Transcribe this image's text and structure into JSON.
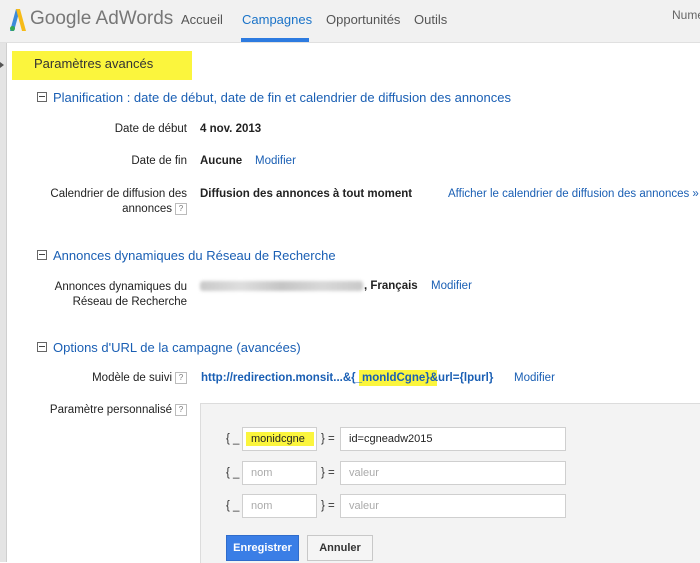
{
  "brand": {
    "google": "Google",
    "product": "AdWords",
    "logo_colors": [
      "#3c8bd9",
      "#f6bb18",
      "#34a853"
    ]
  },
  "nav": {
    "tabs": [
      {
        "label": "Accueil"
      },
      {
        "label": "Campagnes",
        "active": true
      },
      {
        "label": "Opportunités"
      },
      {
        "label": "Outils"
      }
    ],
    "account_label": "Numé"
  },
  "advanced": {
    "title": "Paramètres avancés"
  },
  "scheduling": {
    "header": "Planification : date de début, date de fin et calendrier de diffusion des annonces",
    "start_label": "Date de début",
    "start_value": "4 nov. 2013",
    "end_label": "Date de fin",
    "end_value": "Aucune",
    "end_link": "Modifier",
    "calendar_label_line1": "Calendrier de diffusion des",
    "calendar_label_line2": "annonces",
    "calendar_value": "Diffusion des annonces à tout moment",
    "calendar_link": "Afficher le calendrier de diffusion des annonces »"
  },
  "dsa": {
    "header": "Annonces dynamiques du Réseau de Recherche",
    "label_line1": "Annonces dynamiques du",
    "label_line2": "Réseau de Recherche",
    "value_suffix": ", Français",
    "link": "Modifier"
  },
  "url_options": {
    "header": "Options d'URL de la campagne (avancées)",
    "tracking_label": "Modèle de suivi",
    "tracking_part1": "http://redirection.monsit...&",
    "tracking_part2": "{_monIdCgne}",
    "tracking_part3": "&url={lpurl}",
    "tracking_link": "Modifier",
    "custom_label": "Paramètre personnalisé",
    "help": "?",
    "brace_open": "{ _",
    "brace_close": "} =",
    "params": [
      {
        "name": "monidcgne",
        "value": "id=cgneadw2015"
      },
      {
        "name_placeholder": "nom",
        "value_placeholder": "valeur"
      },
      {
        "name_placeholder": "nom",
        "value_placeholder": "valeur"
      }
    ],
    "save_button": "Enregistrer",
    "cancel_button": "Annuler"
  },
  "colors": {
    "link": "#1a5fb4",
    "highlight": "#fbf53d",
    "primary_button": "#3a7ee6",
    "active_tab": "#2d7be0"
  }
}
